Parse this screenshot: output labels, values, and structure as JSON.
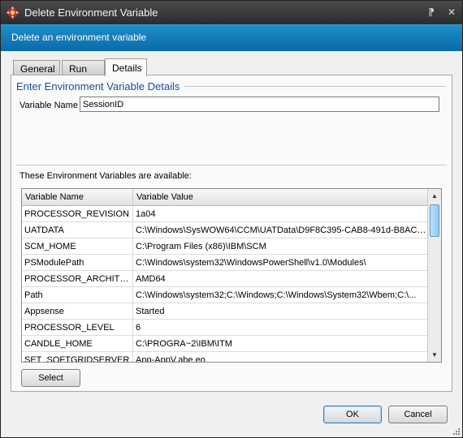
{
  "window": {
    "title": "Delete Environment Variable",
    "title_icon": "shield-gear-icon",
    "pin_glyph": "⁋",
    "close_glyph": "✕"
  },
  "banner": {
    "text": "Delete an environment variable"
  },
  "tabs": [
    {
      "label": "General",
      "active": false
    },
    {
      "label": "Run As",
      "active": false
    },
    {
      "label": "Details",
      "active": true
    }
  ],
  "details": {
    "group_title": "Enter Environment Variable Details",
    "variable_name_label": "Variable Name",
    "variable_name_value": "SessionID",
    "available_label": "These Environment Variables are available:"
  },
  "grid": {
    "columns": [
      "Variable Name",
      "Variable Value"
    ],
    "rows": [
      [
        "PROCESSOR_REVISION",
        "1a04"
      ],
      [
        "UATDATA",
        "C:\\Windows\\SysWOW64\\CCM\\UATData\\D9F8C395-CAB8-491d-B8AC-..."
      ],
      [
        "SCM_HOME",
        "C:\\Program Files (x86)\\IBM\\SCM"
      ],
      [
        "PSModulePath",
        "C:\\Windows\\system32\\WindowsPowerShell\\v1.0\\Modules\\"
      ],
      [
        "PROCESSOR_ARCHITEC...",
        "AMD64"
      ],
      [
        "Path",
        "C:\\Windows\\system32;C:\\Windows;C:\\Windows\\System32\\Wbem;C:\\..."
      ],
      [
        "Appsense",
        "Started"
      ],
      [
        "PROCESSOR_LEVEL",
        "6"
      ],
      [
        "CANDLE_HOME",
        "C:\\PROGRA~2\\IBM\\ITM"
      ],
      [
        "SET_SOFTGRIDSERVER",
        "App-AppV.abe.eo"
      ]
    ]
  },
  "buttons": {
    "select": "Select",
    "ok": "OK",
    "cancel": "Cancel"
  }
}
